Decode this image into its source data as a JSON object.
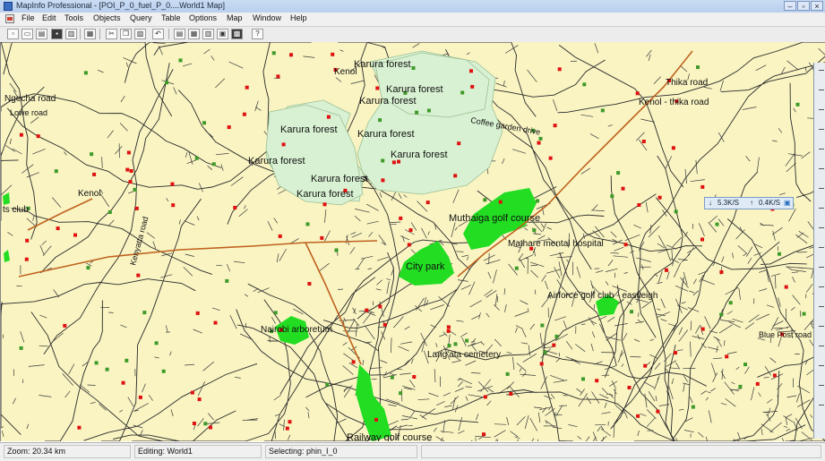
{
  "window": {
    "title": "MapInfo Professional - [POI_P_0_fuel_P_0....World1 Map]",
    "controls": {
      "minimize": "–",
      "restore": "▫",
      "close": "×"
    }
  },
  "menu": {
    "items": [
      "File",
      "Edit",
      "Tools",
      "Objects",
      "Query",
      "Table",
      "Options",
      "Map",
      "Window",
      "Help"
    ]
  },
  "toolbar": {
    "buttons": [
      {
        "name": "new",
        "glyph": "▫"
      },
      {
        "name": "open",
        "glyph": "▭"
      },
      {
        "name": "open-folder",
        "glyph": "▤"
      },
      {
        "name": "save",
        "glyph": "▪"
      },
      {
        "name": "save-copy",
        "glyph": "▥"
      },
      {
        "name": "print",
        "glyph": "▦"
      },
      {
        "name": "cut",
        "glyph": "✂"
      },
      {
        "name": "copy",
        "glyph": "❐"
      },
      {
        "name": "paste",
        "glyph": "▧"
      },
      {
        "name": "undo",
        "glyph": "↶"
      },
      {
        "name": "new-browser",
        "glyph": "▤"
      },
      {
        "name": "new-mapper",
        "glyph": "▦"
      },
      {
        "name": "new-grapher",
        "glyph": "▥"
      },
      {
        "name": "new-layout",
        "glyph": "▣"
      },
      {
        "name": "redistrict",
        "glyph": "▩"
      },
      {
        "name": "help",
        "glyph": "?"
      }
    ]
  },
  "map": {
    "labels": [
      "Karura forest",
      "Karura forest",
      "Karura forest",
      "Karura forest",
      "Karura forest",
      "Karura forest",
      "Karura forest",
      "Karura forest",
      "Karura forest",
      "Muthaiga golf course",
      "City park",
      "Nairobi arboretum",
      "Railway golf course",
      "Kenol - thika road",
      "Thika road",
      "Coffee garden drive",
      "Mathare mental hospital",
      "Airforce golf club - eastleigh",
      "Kenol",
      "Ngecha road",
      "ts club",
      "Kenol",
      "Lang'ata cemetery",
      "Lowe road",
      "Blue Post road",
      "Kenyatta road"
    ],
    "colors": {
      "background": "#f9f4c2",
      "forest": "#d8f1d2",
      "park": "#22dd22",
      "roads": "#222222",
      "highway": "#c0621e",
      "poi_red": "#e01010",
      "poi_green": "#3e9a2a"
    }
  },
  "netspeed": {
    "down": "5.3K/S",
    "up": "0.4K/S"
  },
  "status": {
    "zoom": "Zoom: 20.34 km",
    "editing": "Editing: World1",
    "selecting": "Selecting: phin_I_0"
  }
}
